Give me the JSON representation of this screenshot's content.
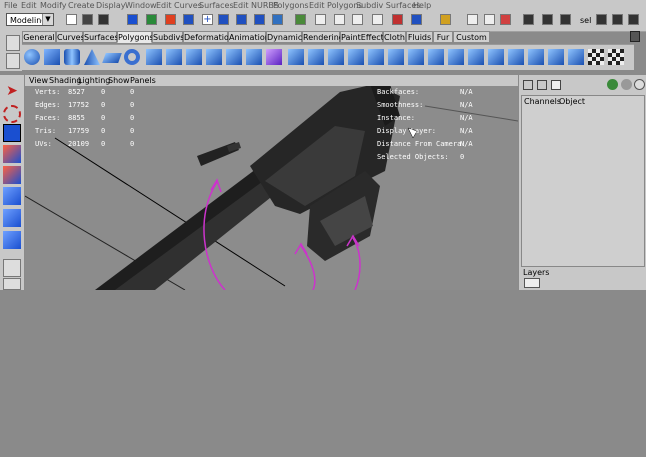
{
  "menubar": {
    "items": [
      "File",
      "Edit",
      "Modify",
      "Create",
      "Display",
      "Window",
      "Edit Curves",
      "Surfaces",
      "Edit NURBS",
      "Polygons",
      "Edit Polygons",
      "Subdiv Surfaces",
      "Help"
    ]
  },
  "toolbar": {
    "mode": "Modeling",
    "sel_label": "sel"
  },
  "shelf": {
    "tabs": [
      "General",
      "Curves",
      "Surfaces",
      "Polygons",
      "Subdivs",
      "Deformation",
      "Animation",
      "Dynamics",
      "Rendering",
      "PaintEffects",
      "Cloth",
      "Fluids",
      "Fur",
      "Custom"
    ],
    "active": "Polygons"
  },
  "viewport": {
    "menu": [
      "View",
      "Shading",
      "Lighting",
      "Show",
      "Panels"
    ],
    "stats": [
      {
        "label": "Verts:",
        "v1": "8527",
        "v2": "0",
        "v3": "0"
      },
      {
        "label": "Edges:",
        "v1": "17752",
        "v2": "0",
        "v3": "0"
      },
      {
        "label": "Faces:",
        "v1": "8855",
        "v2": "0",
        "v3": "0"
      },
      {
        "label": "Tris:",
        "v1": "17759",
        "v2": "0",
        "v3": "0"
      },
      {
        "label": "UVs:",
        "v1": "20109",
        "v2": "0",
        "v3": "0"
      }
    ],
    "heads": [
      {
        "label": "Backfaces:",
        "value": "N/A"
      },
      {
        "label": "Smoothness:",
        "value": "N/A"
      },
      {
        "label": "Instance:",
        "value": "N/A"
      },
      {
        "label": "Display Layer:",
        "value": "N/A"
      },
      {
        "label": "Distance From Camera:",
        "value": "N/A"
      },
      {
        "label": "Selected Objects:",
        "value": "0"
      }
    ]
  },
  "rightpanel": {
    "menu": [
      "Channels",
      "Object"
    ],
    "layers_label": "Layers"
  },
  "colors": {
    "ui_gray": "#c8c8c8",
    "viewport": "#8c8c8c",
    "magenta_arrow": "#cc33cc"
  }
}
